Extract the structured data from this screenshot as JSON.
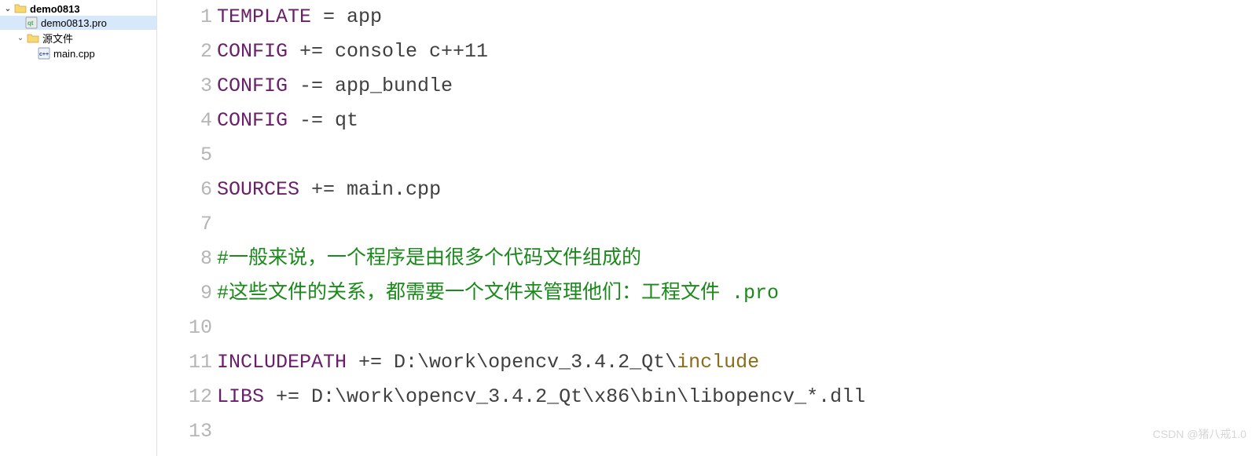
{
  "sidebar": {
    "project": {
      "name": "demo0813"
    },
    "proFile": {
      "name": "demo0813.pro"
    },
    "sourcesFolder": {
      "name": "源文件"
    },
    "mainFile": {
      "name": "main.cpp"
    }
  },
  "editor": {
    "lineNumbers": [
      "1",
      "2",
      "3",
      "4",
      "5",
      "6",
      "7",
      "8",
      "9",
      "10",
      "11",
      "12",
      "13"
    ],
    "l1": {
      "var": "TEMPLATE",
      "op": " = ",
      "val": "app"
    },
    "l2": {
      "var": "CONFIG",
      "op": " += ",
      "val": "console c++11"
    },
    "l3": {
      "var": "CONFIG",
      "op": " -= ",
      "val": "app_bundle"
    },
    "l4": {
      "var": "CONFIG",
      "op": " -= ",
      "val": "qt"
    },
    "l6": {
      "var": "SOURCES",
      "op": " += ",
      "val": "main.cpp"
    },
    "l8": {
      "comment": "#一般来说，一个程序是由很多个代码文件组成的"
    },
    "l9": {
      "comment": "#这些文件的关系，都需要一个文件来管理他们：工程文件 .pro"
    },
    "l11": {
      "var": "INCLUDEPATH",
      "op": " += ",
      "val1": "D:\\work\\opencv_3.4.2_Qt\\",
      "kw": "include"
    },
    "l12": {
      "var": "LIBS",
      "op": " += ",
      "val": "D:\\work\\opencv_3.4.2_Qt\\x86\\bin\\libopencv_*.dll"
    }
  },
  "watermark": "CSDN @猪八戒1.0"
}
